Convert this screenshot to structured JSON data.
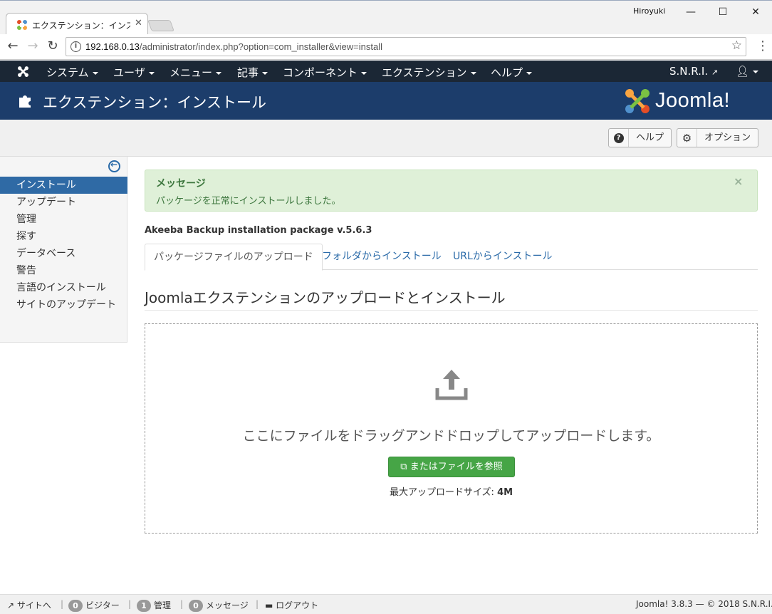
{
  "browser": {
    "tab_title": "エクステンション：インストー",
    "window_user": "Hiroyuki",
    "url_host": "192.168.0.13",
    "url_path": "/administrator/index.php?option=com_installer&view=install"
  },
  "topnav": {
    "items": [
      "システム",
      "ユーザ",
      "メニュー",
      "記事",
      "コンポーネント",
      "エクステンション",
      "ヘルプ"
    ],
    "site_name": "S.N.R.I."
  },
  "header": {
    "title": "エクステンション：インストール",
    "logo_text": "Joomla!"
  },
  "toolbar": {
    "help_label": "ヘルプ",
    "options_label": "オプション"
  },
  "sidebar": {
    "items": [
      {
        "label": "インストール",
        "active": true
      },
      {
        "label": "アップデート",
        "active": false
      },
      {
        "label": "管理",
        "active": false
      },
      {
        "label": "探す",
        "active": false
      },
      {
        "label": "データベース",
        "active": false
      },
      {
        "label": "警告",
        "active": false
      },
      {
        "label": "言語のインストール",
        "active": false
      },
      {
        "label": "サイトのアップデート",
        "active": false
      }
    ]
  },
  "alert": {
    "heading": "メッセージ",
    "message": "パッケージを正常にインストールしました。"
  },
  "package_title": "Akeeba Backup installation package v.5.6.3",
  "tabs": [
    {
      "label": "パッケージファイルのアップロード",
      "active": true
    },
    {
      "label": "フォルダからインストール",
      "active": false
    },
    {
      "label": "URLからインストール",
      "active": false
    }
  ],
  "section_title": "Joomlaエクステンションのアップロードとインストール",
  "dropzone": {
    "text": "ここにファイルをドラッグアンドドロップしてアップロードします。",
    "browse_label": "またはファイルを参照",
    "max_label": "最大アップロードサイズ:",
    "max_value": "4M"
  },
  "footer": {
    "site_link": "サイトへ",
    "visitors_count": "0",
    "visitors_label": "ビジター",
    "admins_count": "1",
    "admins_label": "管理",
    "messages_count": "0",
    "messages_label": "メッセージ",
    "logout_label": "ログアウト",
    "copyright": "Joomla! 3.8.3 — © 2018 S.N.R.I."
  },
  "colors": {
    "topnav_bg": "#1b2735",
    "header_bg": "#1c3d6b",
    "sidebar_active": "#2f6aa5",
    "alert_bg": "#dff0d8",
    "browse_button": "#46a546"
  }
}
